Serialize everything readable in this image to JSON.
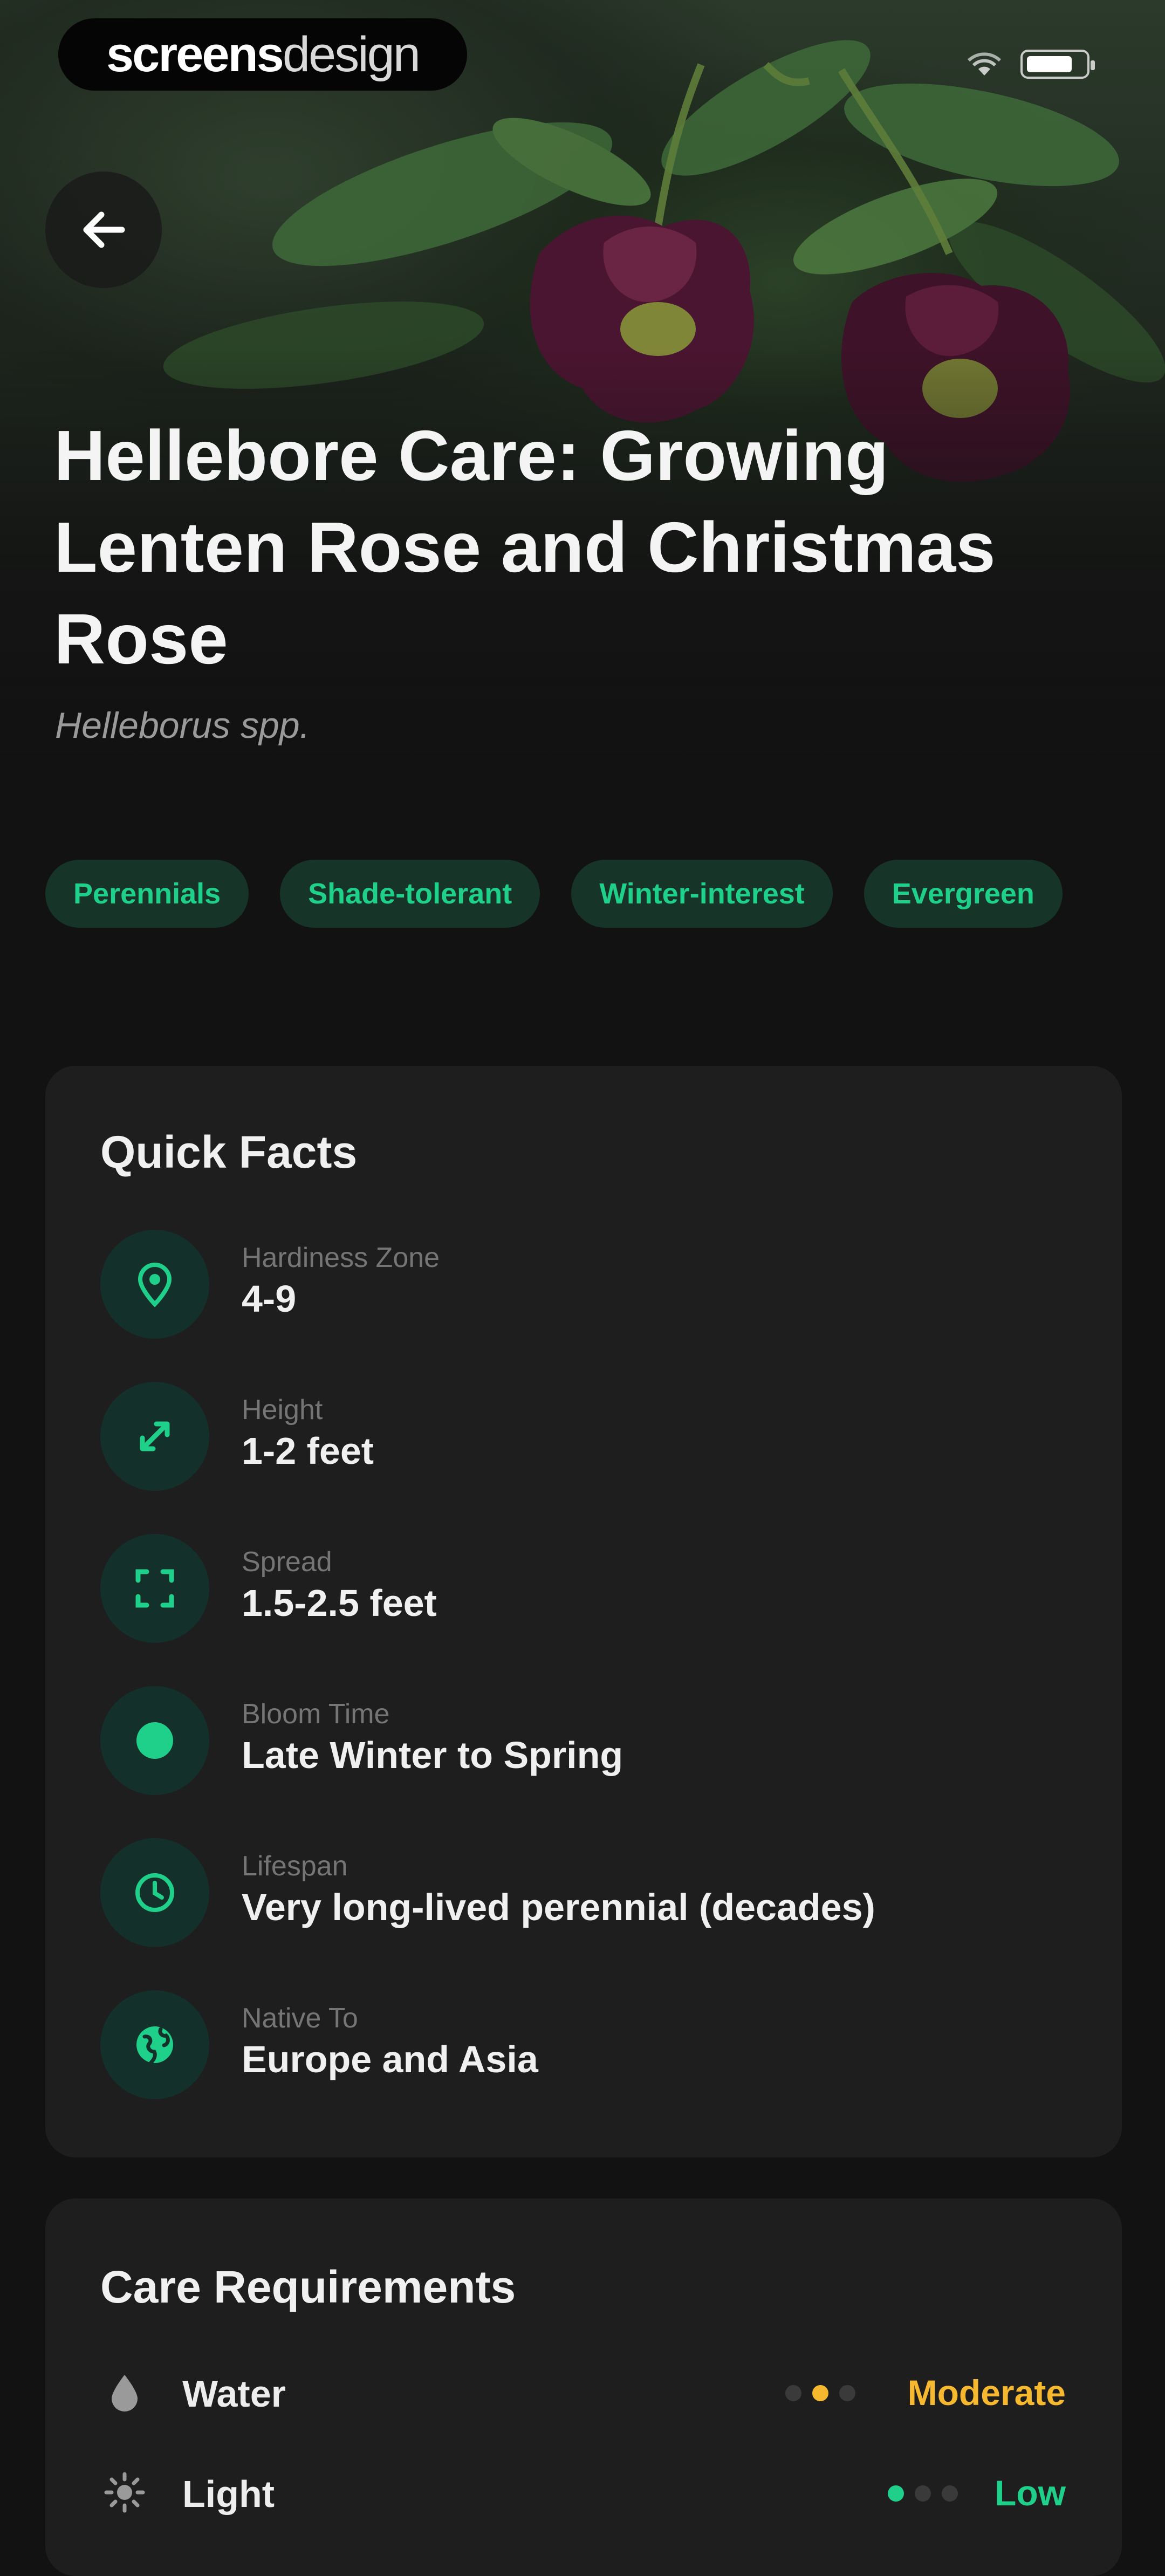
{
  "brand": {
    "bold": "screens",
    "light": "design"
  },
  "status_bar": {
    "icons": [
      "wifi-icon",
      "battery-icon"
    ],
    "battery_level": 0.8
  },
  "header": {
    "back_icon": "arrow-left-icon",
    "title": "Hellebore Care: Growing Lenten Rose and Christmas Rose",
    "scientific_name": "Helleborus spp."
  },
  "tags": [
    "Perennials",
    "Shade-tolerant",
    "Winter-interest",
    "Evergreen"
  ],
  "quick_facts": {
    "heading": "Quick Facts",
    "items": [
      {
        "icon": "location-pin-icon",
        "label": "Hardiness Zone",
        "value": "4-9"
      },
      {
        "icon": "height-arrow-icon",
        "label": "Height",
        "value": "1-2 feet"
      },
      {
        "icon": "expand-icon",
        "label": "Spread",
        "value": "1.5-2.5 feet"
      },
      {
        "icon": "bloom-icon",
        "label": "Bloom Time",
        "value": "Late Winter to Spring"
      },
      {
        "icon": "clock-icon",
        "label": "Lifespan",
        "value": "Very long-lived perennial (decades)"
      },
      {
        "icon": "globe-icon",
        "label": "Native To",
        "value": "Europe and Asia"
      }
    ]
  },
  "care": {
    "heading": "Care Requirements",
    "items": [
      {
        "icon": "water-drop-icon",
        "label": "Water",
        "level": "Moderate",
        "level_index": 2,
        "level_max": 3,
        "color": "#f5b82e"
      },
      {
        "icon": "sun-icon",
        "label": "Light",
        "level": "Low",
        "level_index": 1,
        "level_max": 3,
        "color": "#1fd08a"
      }
    ]
  },
  "colors": {
    "accent": "#1fd08a",
    "tag_bg": "#173429",
    "card_bg": "#1e1e1e",
    "warning": "#f5b82e"
  }
}
